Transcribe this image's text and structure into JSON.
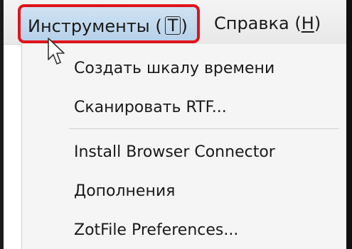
{
  "menubar": {
    "tools": {
      "label": "Инструменты",
      "accel": "T"
    },
    "help": {
      "label": "Справка",
      "accel": "H"
    }
  },
  "dropdown": {
    "items": [
      {
        "label": "Создать шкалу времени"
      },
      {
        "label": "Сканировать RTF..."
      },
      {
        "label": "Install Browser Connector"
      },
      {
        "label": "Дополнения"
      },
      {
        "label": "ZotFile Preferences..."
      }
    ]
  },
  "highlight_color": "#e0141c",
  "cursor_icon": "mouse-pointer-icon"
}
